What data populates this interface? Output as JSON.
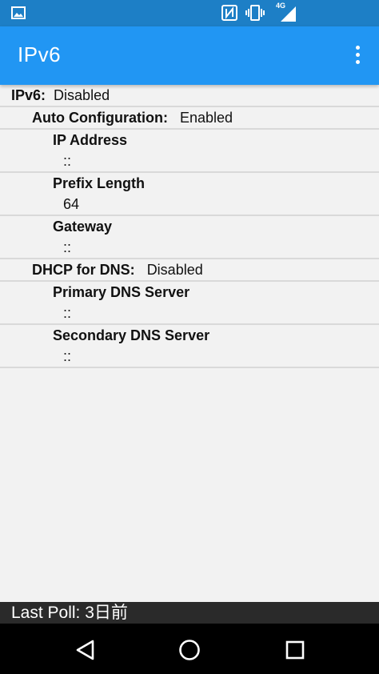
{
  "status_bar": {
    "network_label": "4G",
    "icons": [
      "image-icon",
      "nfc-icon",
      "vibrate-icon",
      "signal-icon",
      "battery-icon"
    ]
  },
  "app_bar": {
    "title": "IPv6",
    "overflow_icon": "more-vert-icon"
  },
  "ipv6": {
    "label": "IPv6:",
    "value": "Disabled",
    "auto_config": {
      "label": "Auto Configuration:",
      "value": "Enabled"
    },
    "ip_address": {
      "label": "IP Address",
      "value": "::"
    },
    "prefix_length": {
      "label": "Prefix Length",
      "value": "64"
    },
    "gateway": {
      "label": "Gateway",
      "value": "::"
    },
    "dhcp_dns": {
      "label": "DHCP for DNS:",
      "value": "Disabled"
    },
    "primary_dns": {
      "label": "Primary DNS Server",
      "value": "::"
    },
    "secondary_dns": {
      "label": "Secondary DNS Server",
      "value": "::"
    }
  },
  "footer": {
    "last_poll": "Last Poll: 3日前"
  },
  "nav_bar": {
    "icons": [
      "back-icon",
      "home-icon",
      "recents-icon"
    ]
  },
  "colors": {
    "status_bar": "#1d7fc6",
    "app_bar": "#2196f3",
    "background": "#f2f2f2",
    "footer": "#2a2a2a",
    "nav_bar": "#000000"
  }
}
